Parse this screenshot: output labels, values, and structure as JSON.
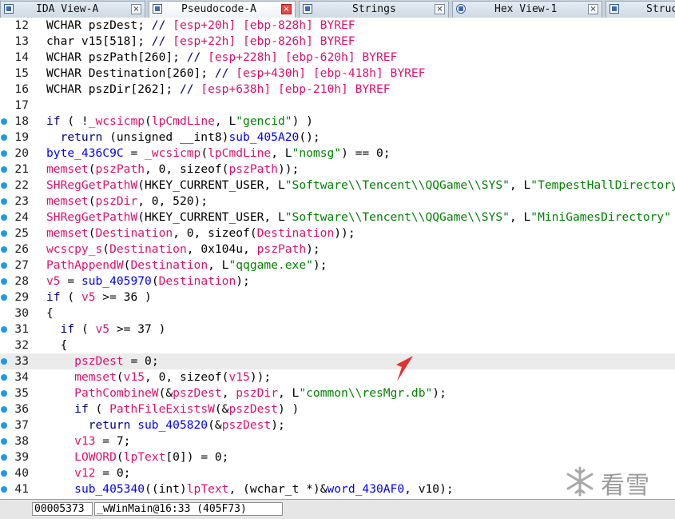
{
  "tabs": [
    {
      "label": "IDA View-A",
      "active": false
    },
    {
      "label": "Pseudocode-A",
      "active": true
    },
    {
      "label": "Strings",
      "active": false
    },
    {
      "label": "Hex View-1",
      "active": false
    },
    {
      "label": "Struc",
      "active": false
    }
  ],
  "close_glyph": "×",
  "code_lines": [
    {
      "n": "12",
      "dot": false,
      "html": "WCHAR pszDest; <span class=\"cm\">// </span><span class=\"cv\">[esp+20h] [ebp-828h] BYREF</span>"
    },
    {
      "n": "13",
      "dot": false,
      "html": "char v15[518]; <span class=\"cm\">// </span><span class=\"cv\">[esp+22h] [ebp-826h] BYREF</span>"
    },
    {
      "n": "14",
      "dot": false,
      "html": "WCHAR pszPath[260]; <span class=\"cm\">// </span><span class=\"cv\">[esp+228h] [ebp-620h] BYREF</span>"
    },
    {
      "n": "15",
      "dot": false,
      "html": "WCHAR Destination[260]; <span class=\"cm\">// </span><span class=\"cv\">[esp+430h] [ebp-418h] BYREF</span>"
    },
    {
      "n": "16",
      "dot": false,
      "html": "WCHAR pszDir[262]; <span class=\"cm\">// </span><span class=\"cv\">[esp+638h] [ebp-210h] BYREF</span>"
    },
    {
      "n": "17",
      "dot": false,
      "html": ""
    },
    {
      "n": "18",
      "dot": true,
      "html": "<span class=\"kw\">if</span> ( !<span class=\"fn\">_wcsicmp</span>(<span class=\"vr\">lpCmdLine</span>, L<span class=\"sr\">\"gencid\"</span>) )"
    },
    {
      "n": "19",
      "dot": true,
      "html": "  <span class=\"kw\">return</span> (unsigned __int8)<span class=\"gb\">sub_405A20</span>();"
    },
    {
      "n": "20",
      "dot": true,
      "html": "<span class=\"gb\">byte_436C9C</span> = <span class=\"fn\">_wcsicmp</span>(<span class=\"vr\">lpCmdLine</span>, L<span class=\"sr\">\"nomsg\"</span>) == 0;"
    },
    {
      "n": "21",
      "dot": true,
      "html": "<span class=\"fn\">memset</span>(<span class=\"vr\">pszPath</span>, 0, sizeof(<span class=\"vr\">pszPath</span>));"
    },
    {
      "n": "22",
      "dot": true,
      "html": "<span class=\"fn\">SHRegGetPathW</span>(HKEY_CURRENT_USER, L<span class=\"sr\">\"Software\\\\Tencent\\\\QQGame\\\\SYS\"</span>, L<span class=\"sr\">\"TempestHallDirectory\"</span>"
    },
    {
      "n": "23",
      "dot": true,
      "html": "<span class=\"fn\">memset</span>(<span class=\"vr\">pszDir</span>, 0, 520);"
    },
    {
      "n": "24",
      "dot": true,
      "html": "<span class=\"fn\">SHRegGetPathW</span>(HKEY_CURRENT_USER, L<span class=\"sr\">\"Software\\\\Tencent\\\\QQGame\\\\SYS\"</span>, L<span class=\"sr\">\"MiniGamesDirectory\"</span>"
    },
    {
      "n": "25",
      "dot": true,
      "html": "<span class=\"fn\">memset</span>(<span class=\"vr\">Destination</span>, 0, sizeof(<span class=\"vr\">Destination</span>));"
    },
    {
      "n": "26",
      "dot": true,
      "html": "<span class=\"fn\">wcscpy_s</span>(<span class=\"vr\">Destination</span>, 0x104u, <span class=\"vr\">pszPath</span>);"
    },
    {
      "n": "27",
      "dot": true,
      "html": "<span class=\"fn\">PathAppendW</span>(<span class=\"vr\">Destination</span>, L<span class=\"sr\">\"qqgame.exe\"</span>);"
    },
    {
      "n": "28",
      "dot": true,
      "html": "<span class=\"vr\">v5</span> = <span class=\"gb\">sub_405970</span>(<span class=\"vr\">Destination</span>);"
    },
    {
      "n": "29",
      "dot": true,
      "html": "<span class=\"kw\">if</span> ( <span class=\"vr\">v5</span> >= 36 )"
    },
    {
      "n": "30",
      "dot": false,
      "html": "{"
    },
    {
      "n": "31",
      "dot": true,
      "html": "  <span class=\"kw\">if</span> ( <span class=\"vr\">v5</span> >= 37 )"
    },
    {
      "n": "32",
      "dot": false,
      "html": "  {"
    },
    {
      "n": "33",
      "dot": true,
      "hl": true,
      "html": "    <span class=\"vr\">pszDest</span> = 0;"
    },
    {
      "n": "34",
      "dot": true,
      "html": "    <span class=\"fn\">memset</span>(<span class=\"vr\">v15</span>, 0, sizeof(<span class=\"vr\">v15</span>));"
    },
    {
      "n": "35",
      "dot": true,
      "html": "    <span class=\"fn\">PathCombineW</span>(&amp;<span class=\"vr\">pszDest</span>, <span class=\"vr\">pszDir</span>, L<span class=\"sr\">\"common\\\\resMgr.db\"</span>);"
    },
    {
      "n": "36",
      "dot": true,
      "html": "    <span class=\"kw\">if</span> ( <span class=\"fn\">PathFileExistsW</span>(&amp;<span class=\"vr\">pszDest</span>) )"
    },
    {
      "n": "37",
      "dot": true,
      "html": "      <span class=\"kw\">return</span> <span class=\"gb\">sub_405820</span>(&amp;<span class=\"vr\">pszDest</span>);"
    },
    {
      "n": "38",
      "dot": true,
      "html": "    <span class=\"vr\">v13</span> = 7;"
    },
    {
      "n": "39",
      "dot": true,
      "html": "    <span class=\"fn\">LOWORD</span>(<span class=\"vr\">lpText</span>[0]) = 0;"
    },
    {
      "n": "40",
      "dot": true,
      "html": "    <span class=\"vr\">v12</span> = 0;"
    },
    {
      "n": "41",
      "dot": true,
      "html": "    <span class=\"gb\">sub_405340</span>((int)<span class=\"vr\">lpText</span>, (wchar_t *)&amp;<span class=\"gb\">word_430AF0</span>, v10);"
    }
  ],
  "status": {
    "address": "00005373",
    "location": "_wWinMain@16:33 (405F73)"
  },
  "watermark": {
    "text": "看雪"
  },
  "colors": {
    "accent_arrow": "#e53030",
    "breakpoint_dot": "#1b9be8"
  }
}
